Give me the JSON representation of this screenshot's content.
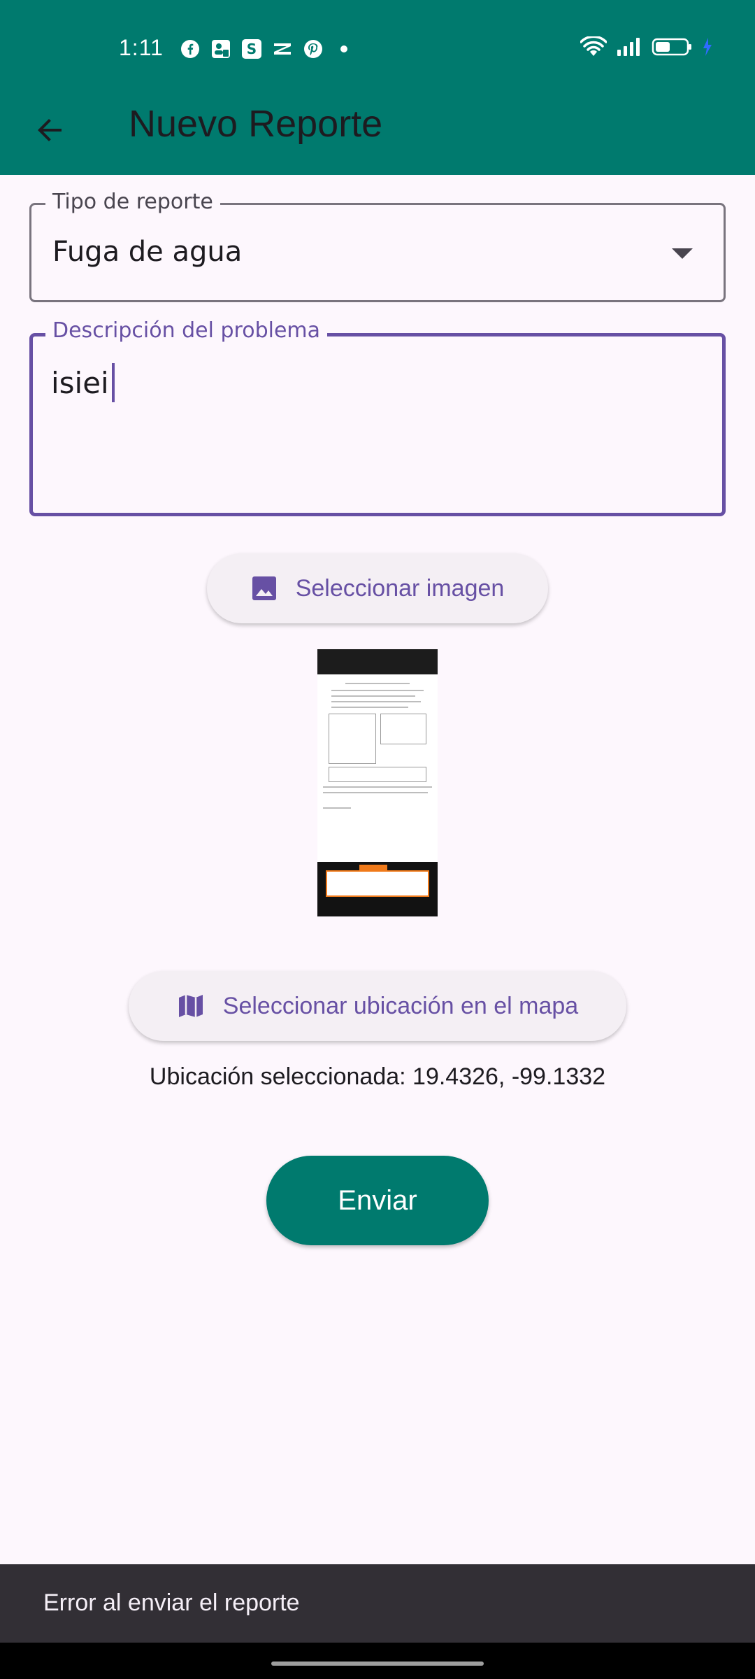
{
  "status_bar": {
    "time": "1:11",
    "notification_icons": [
      "facebook-icon",
      "facebook-pages-icon",
      "s-app-icon",
      "capcut-icon",
      "pinterest-icon",
      "more-dot-icon"
    ],
    "system_icons": [
      "wifi-icon",
      "signal-icon",
      "battery-icon",
      "charging-icon"
    ]
  },
  "app_bar": {
    "title": "Nuevo Reporte",
    "back_icon": "arrow-back-icon"
  },
  "form": {
    "report_type": {
      "label": "Tipo de reporte",
      "value": "Fuga de agua"
    },
    "description": {
      "label": "Descripción del problema",
      "value": "isiei"
    }
  },
  "buttons": {
    "select_image": "Seleccionar imagen",
    "select_location": "Seleccionar ubicación en el mapa",
    "submit": "Enviar"
  },
  "location_text": "Ubicación seleccionada: 19.4326, -99.1332",
  "snackbar": {
    "message": "Error al enviar el reporte"
  },
  "colors": {
    "primary_teal": "#007A6E",
    "accent_purple": "#6750A4",
    "background": "#FDF7FD",
    "snackbar": "#322F35"
  }
}
